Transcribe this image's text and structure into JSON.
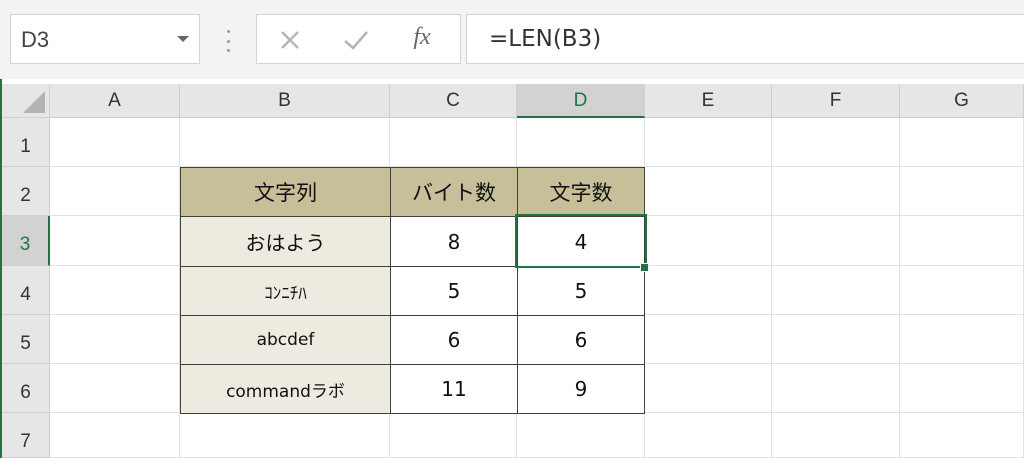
{
  "name_box": {
    "value": "D3"
  },
  "formula_bar": {
    "cancel_icon": "close-icon",
    "enter_icon": "check-icon",
    "fx_label": "fx",
    "value": "=LEN(B3)"
  },
  "columns": [
    "A",
    "B",
    "C",
    "D",
    "E",
    "F",
    "G"
  ],
  "rows": [
    "1",
    "2",
    "3",
    "4",
    "5",
    "6",
    "7"
  ],
  "selected": {
    "column": "D",
    "row": "3"
  },
  "table": {
    "headers": [
      "文字列",
      "バイト数",
      "文字数"
    ],
    "rows": [
      [
        "おはよう",
        "8",
        "4"
      ],
      [
        "ｺﾝﾆﾁﾊ",
        "5",
        "5"
      ],
      [
        "abcdef",
        "6",
        "6"
      ],
      [
        "commandラボ",
        "11",
        "9"
      ]
    ]
  },
  "colors": {
    "accent": "#217346",
    "header_fill": "#c7bf99",
    "body_fill": "#edeae0"
  }
}
